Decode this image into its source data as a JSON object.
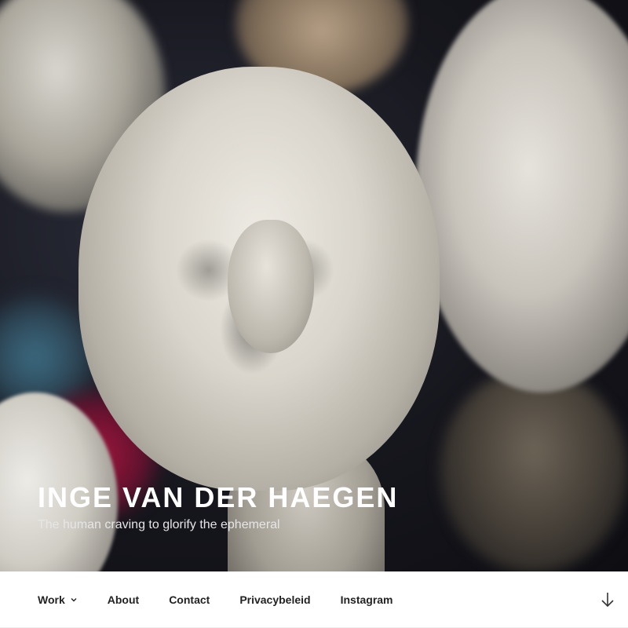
{
  "site": {
    "title": "INGE VAN DER HAEGEN",
    "description": "The human craving to glorify the ephemeral"
  },
  "menu": {
    "items": [
      {
        "label": "Work",
        "has_submenu": true
      },
      {
        "label": "About"
      },
      {
        "label": "Contact"
      },
      {
        "label": "Privacybeleid"
      },
      {
        "label": "Instagram"
      }
    ]
  },
  "icons": {
    "submenu": "chevron-down-icon",
    "scroll": "arrow-down-icon"
  },
  "colors": {
    "title": "#ffffff",
    "menu_text": "#222222",
    "nav_background": "#ffffff"
  }
}
